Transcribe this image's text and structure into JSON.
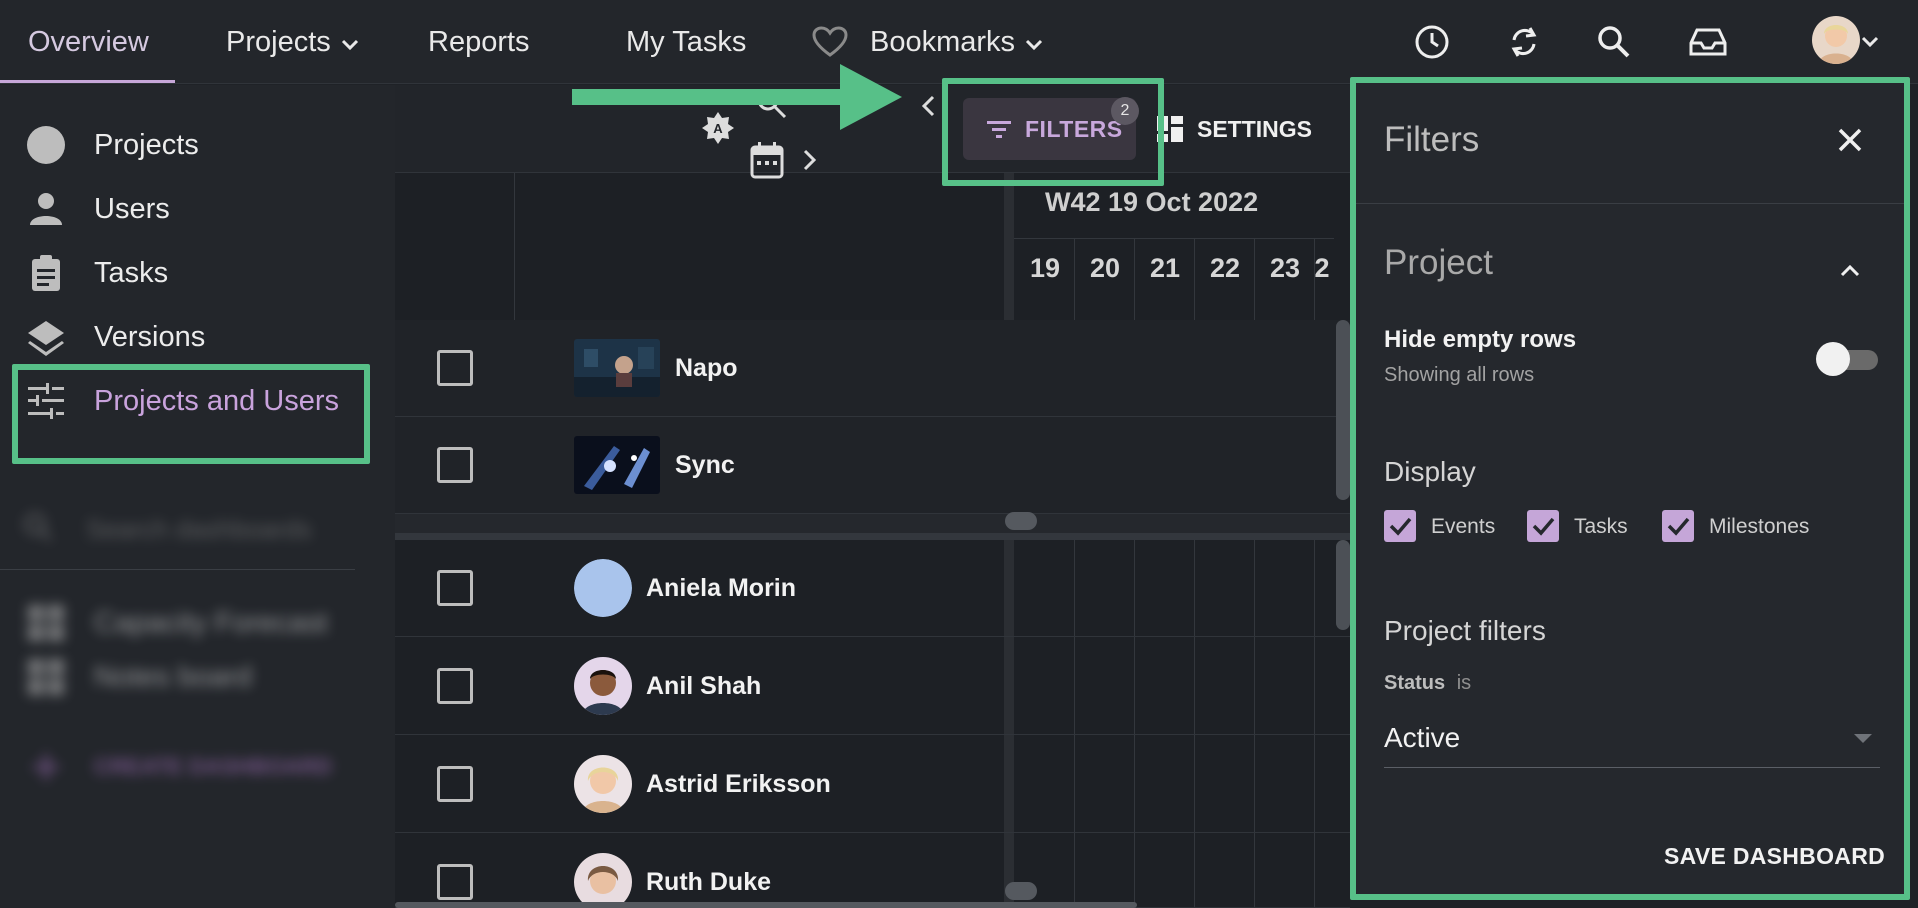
{
  "nav": {
    "overview": "Overview",
    "projects": "Projects",
    "reports": "Reports",
    "my_tasks": "My Tasks",
    "bookmarks": "Bookmarks"
  },
  "sidebar": {
    "items": [
      {
        "label": "Projects",
        "icon": "circle-icon"
      },
      {
        "label": "Users",
        "icon": "user-icon"
      },
      {
        "label": "Tasks",
        "icon": "clipboard-icon"
      },
      {
        "label": "Versions",
        "icon": "layers-icon"
      },
      {
        "label": "Projects and Users",
        "icon": "sliders-icon"
      }
    ],
    "search_placeholder": "Search dashboards",
    "dashboards": [
      {
        "label": "Capacity Forecast"
      },
      {
        "label": "Notes board"
      }
    ],
    "create_label": "CREATE DASHBOARD"
  },
  "toolbar": {
    "filters_label": "FILTERS",
    "filters_count": "2",
    "settings_label": "SETTINGS"
  },
  "timeline": {
    "week_label": "W42 19 Oct 2022",
    "days": [
      "19",
      "20",
      "21",
      "22",
      "23",
      "2"
    ]
  },
  "projects": [
    {
      "name": "Napo"
    },
    {
      "name": "Sync"
    }
  ],
  "users": [
    {
      "name": "Aniela Morin"
    },
    {
      "name": "Anil Shah"
    },
    {
      "name": "Astrid Eriksson"
    },
    {
      "name": "Ruth Duke"
    }
  ],
  "panel": {
    "title": "Filters",
    "section_title": "Project",
    "hide_empty_title": "Hide empty rows",
    "hide_empty_sub": "Showing all rows",
    "display_title": "Display",
    "display_options": [
      "Events",
      "Tasks",
      "Milestones"
    ],
    "project_filters_title": "Project filters",
    "status_label": "Status",
    "status_op": "is",
    "status_value": "Active",
    "save_label": "SAVE DASHBOARD"
  },
  "colors": {
    "accent": "#c7a7d9",
    "highlight": "#57c088",
    "background": "#1f2227"
  }
}
